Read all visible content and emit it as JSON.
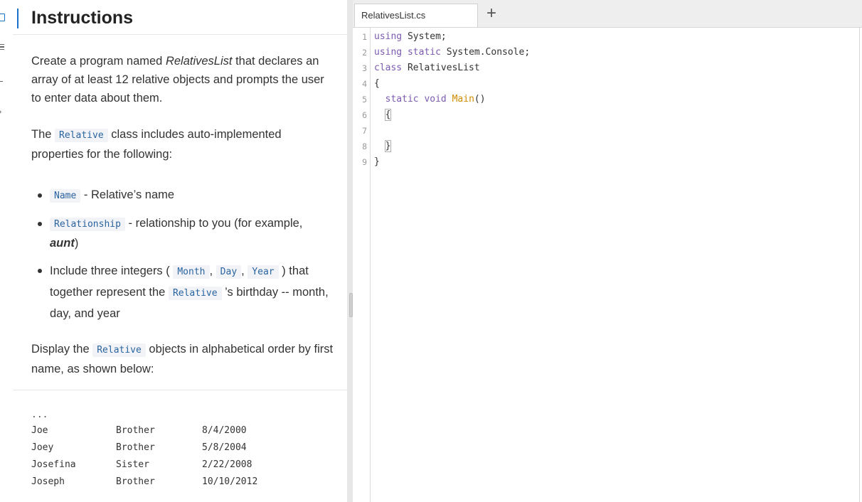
{
  "instructions": {
    "title": "Instructions",
    "p1_pre": "Create a program named ",
    "p1_em": "RelativesList",
    "p1_post": " that declares an array of at least 12 relative objects and prompts the user to enter data about them.",
    "p2_pre": "The ",
    "p2_code": "Relative",
    "p2_post": " class includes auto-implemented properties for the following:",
    "bullets": {
      "b1_code": "Name",
      "b1_text": " - Relative’s name",
      "b2_code": "Relationship",
      "b2_text": " - relationship to you (for example, ",
      "b2_em": "aunt",
      "b2_end": ")",
      "b3_pre": "Include three integers ( ",
      "b3_c1": "Month",
      "b3_sep1": ", ",
      "b3_c2": "Day",
      "b3_sep2": ", ",
      "b3_c3": "Year",
      "b3_mid": " ) that together represent the ",
      "b3_c4": "Relative",
      "b3_post": " ’s birthday -- month, day, and year"
    },
    "p3_pre": "Display the ",
    "p3_code": "Relative",
    "p3_post": " objects in alphabetical order by first name, as shown below:"
  },
  "output": {
    "dots": "...",
    "rows": [
      {
        "name": "Joe",
        "rel": "Brother",
        "date": "8/4/2000"
      },
      {
        "name": "Joey",
        "rel": "Brother",
        "date": "5/8/2004"
      },
      {
        "name": "Josefina",
        "rel": "Sister",
        "date": "2/22/2008"
      },
      {
        "name": "Joseph",
        "rel": "Brother",
        "date": "10/10/2012"
      }
    ]
  },
  "editor": {
    "tab_label": "RelativesList.cs",
    "add_tab": "+",
    "line_numbers": [
      "1",
      "2",
      "3",
      "4",
      "5",
      "6",
      "7",
      "8",
      "9"
    ],
    "code": {
      "l1_kw": "using",
      "l1_rest": " System;",
      "l2_kw1": "using",
      "l2_kw2": "static",
      "l2_rest": " System.Console;",
      "l3_kw": "class",
      "l3_rest": " RelativesList",
      "l4": "{",
      "l5_indent": "  ",
      "l5_kw1": "static",
      "l5_kw2": "void",
      "l5_fn": "Main",
      "l5_rest": "()",
      "l6_indent": "  ",
      "l6": "{",
      "l8_indent": "  ",
      "l8": "}",
      "l9": "}"
    }
  },
  "colors": {
    "accent": "#1a73c8",
    "keyword": "#7b5ab0",
    "method": "#d18c00",
    "inline_code": "#2a64a0"
  }
}
